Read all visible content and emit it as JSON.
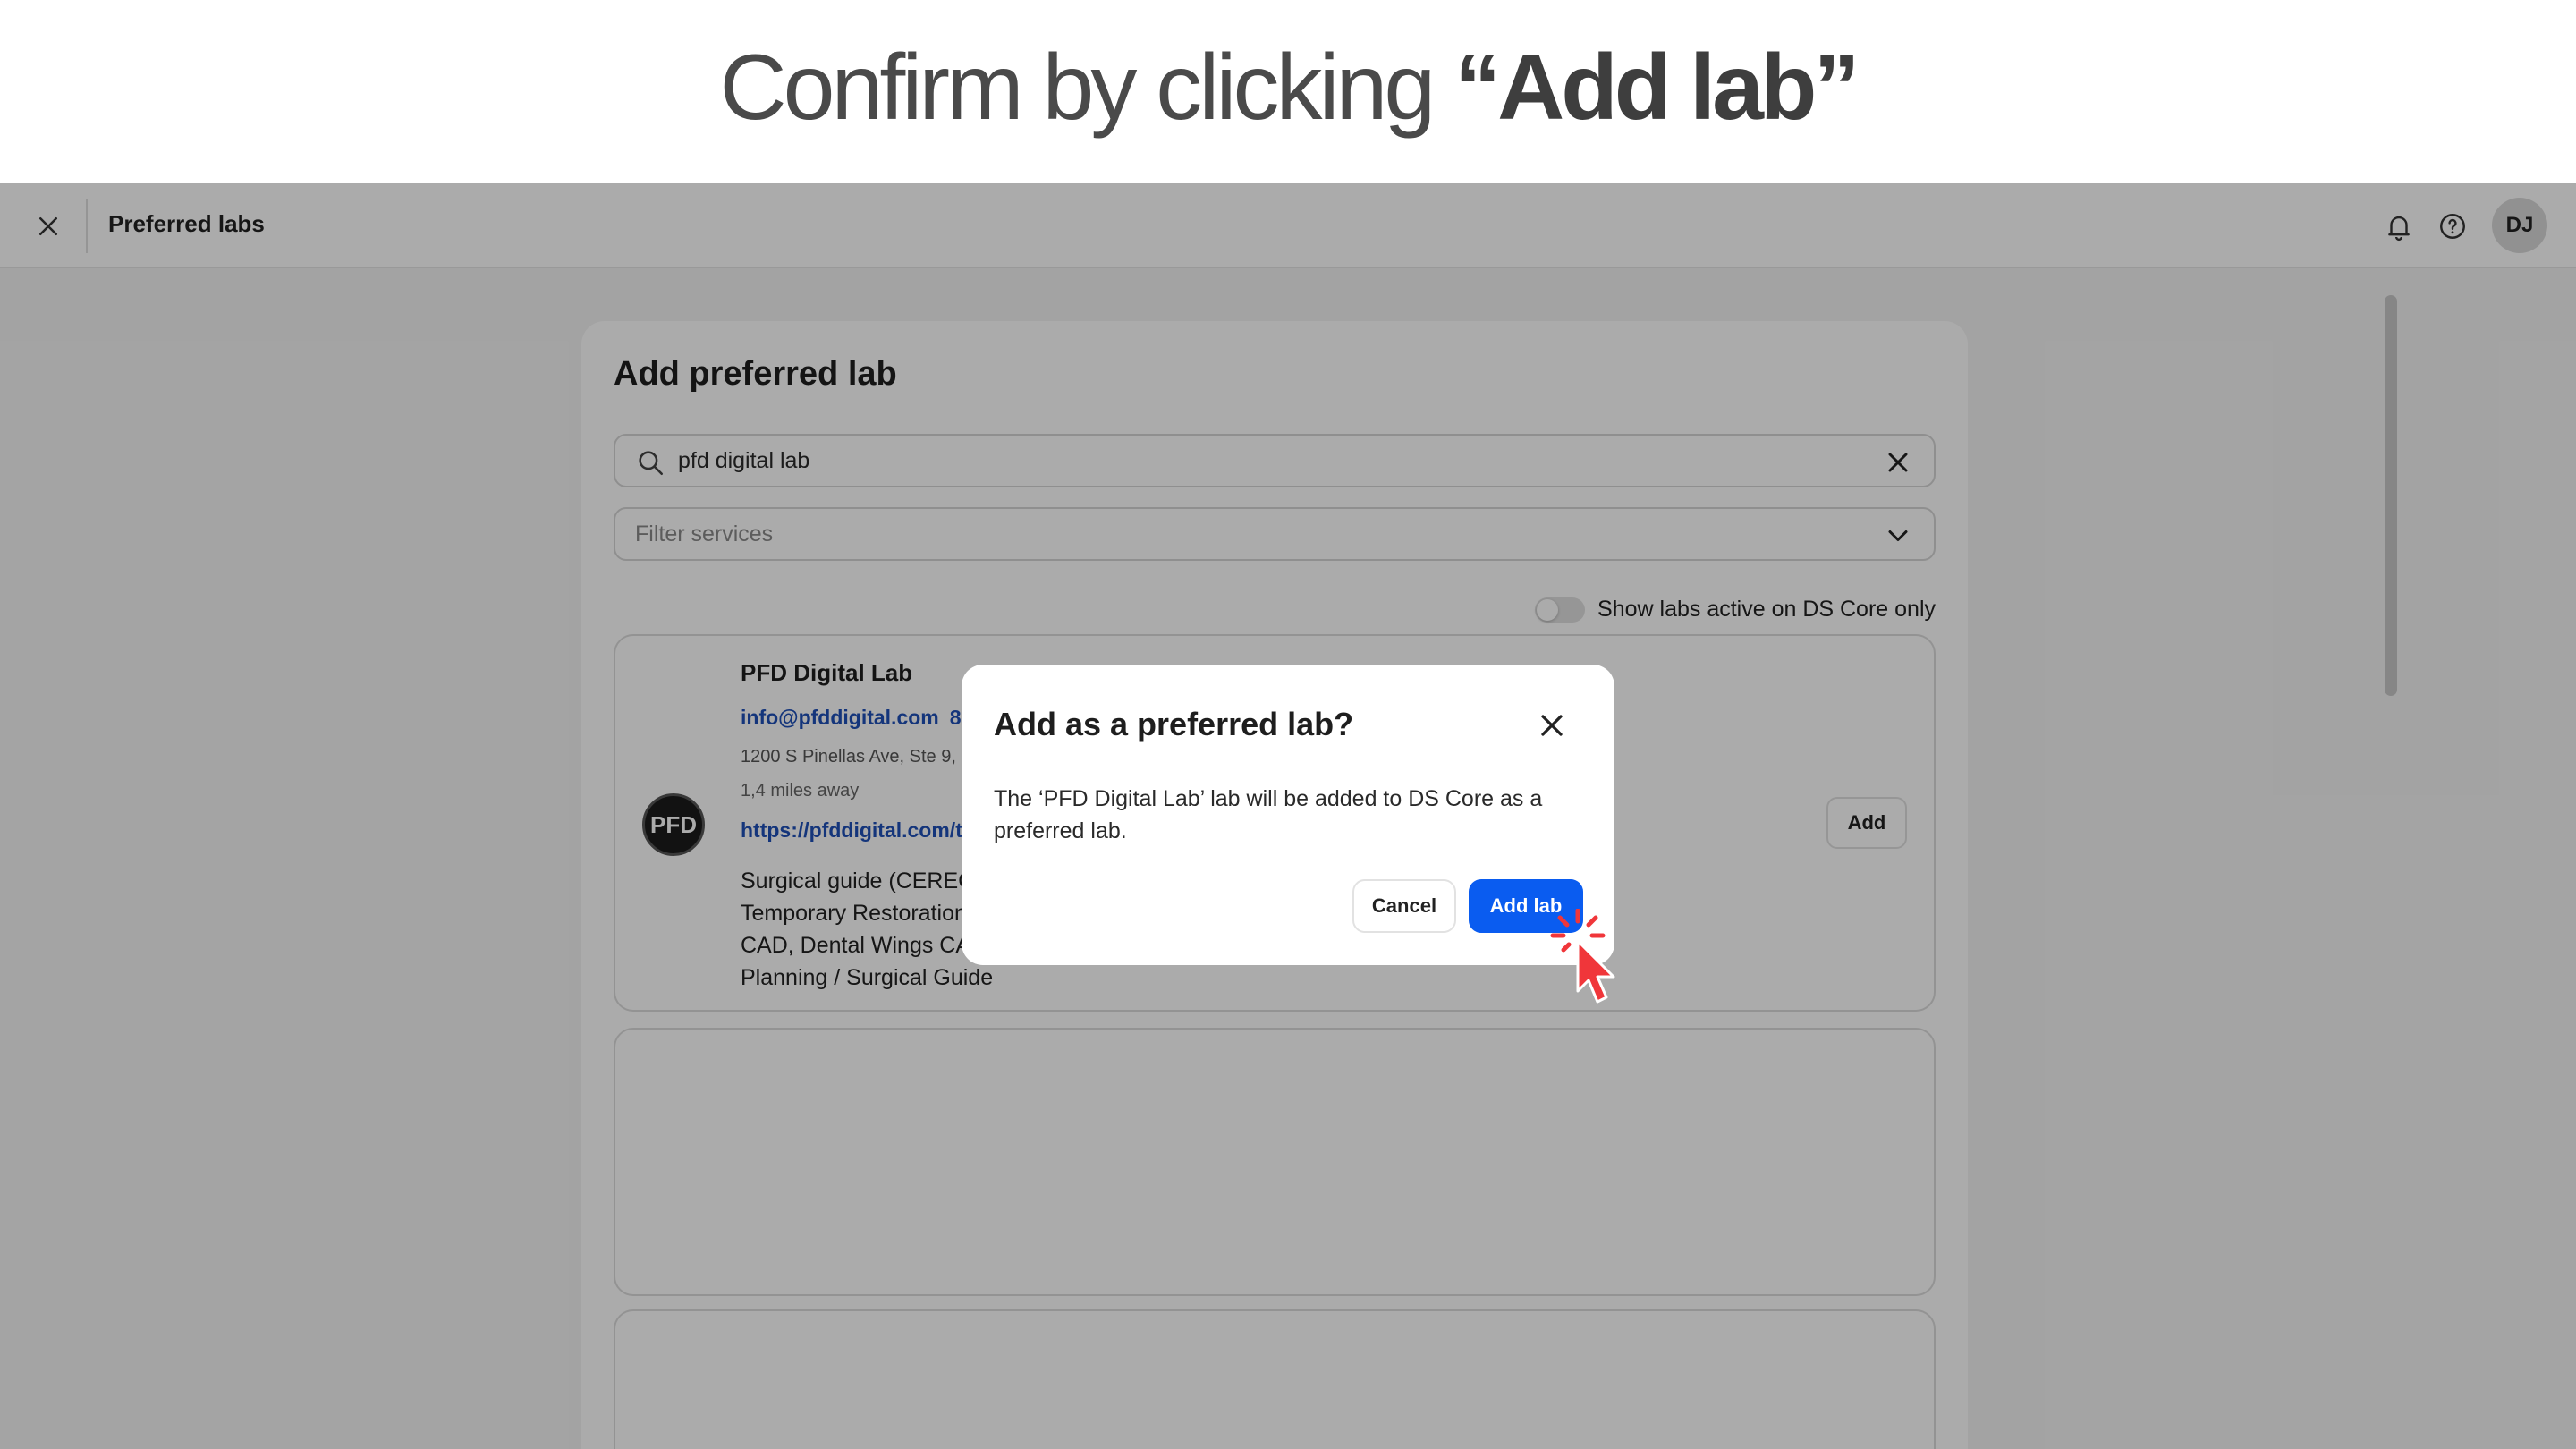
{
  "caption": {
    "prefix": "Confirm by clicking ",
    "emphasis": "“Add lab”"
  },
  "topbar": {
    "title": "Preferred labs",
    "avatar_initials": "DJ",
    "icons": [
      "close-icon",
      "bell-icon",
      "help-icon"
    ]
  },
  "panel": {
    "title": "Add preferred lab",
    "search": {
      "value": "pfd digital lab"
    },
    "filter": {
      "placeholder": "Filter services"
    },
    "toggle": {
      "label": "Show labs active on DS Core only",
      "on": false
    }
  },
  "lab": {
    "logo_text": "PFD",
    "name": "PFD Digital Lab",
    "email": "info@pfddigital.com",
    "phone": "85",
    "address": "1200 S Pinellas Ave, Ste 9, 346",
    "distance": "1,4 miles away",
    "website": "https://pfddigital.com/te",
    "services_lines": [
      "Surgical guide (CEREC                                                                   tguard / Splint,",
      "Temporary Restoration                                                                   n, Other 3rd party",
      "CAD, Dental Wings CA                                                                    guides, Implant",
      "Planning / Surgical Guide"
    ],
    "add_label": "Add"
  },
  "dialog": {
    "title": "Add as a preferred lab?",
    "body": "The ‘PFD Digital Lab’ lab will be added to DS Core as a preferred lab.",
    "cancel_label": "Cancel",
    "confirm_label": "Add lab"
  },
  "colors": {
    "accent": "#0a5cf0",
    "link": "#1f4fb8",
    "cursor": "#f0363a",
    "overlay": "rgba(0,0,0,0.33)"
  }
}
